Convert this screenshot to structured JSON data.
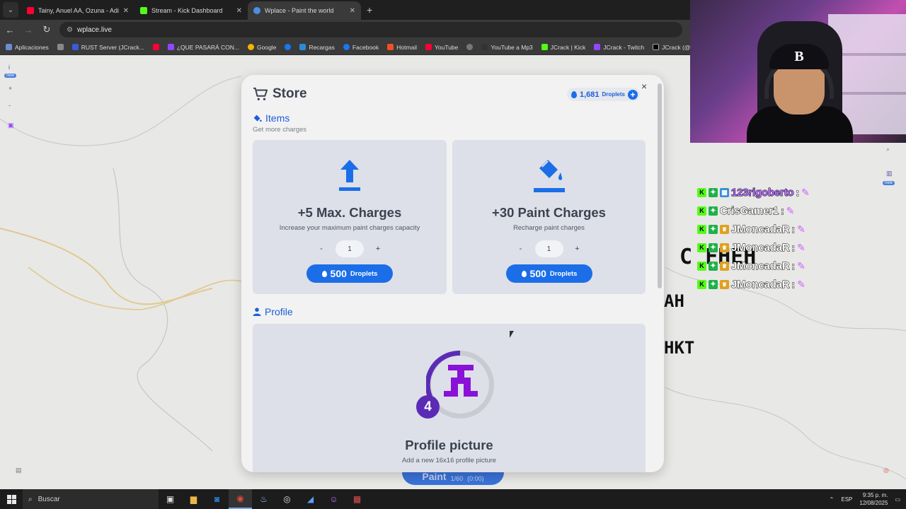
{
  "browser": {
    "tabs": [
      {
        "title": "Tainy, Anuel AA, Ozuna - Adicto",
        "color": "#ff0033",
        "active": false
      },
      {
        "title": "Stream - Kick Dashboard",
        "color": "#53fc18",
        "active": false
      },
      {
        "title": "Wplace - Paint the world",
        "color": "#4a90e2",
        "active": true
      }
    ],
    "new_tab_label": "+",
    "url": "wplace.live",
    "bookmarks": [
      {
        "label": "Aplicaciones",
        "color": "#6d8cd0"
      },
      {
        "label": "",
        "color": "#888888"
      },
      {
        "label": "RUST Server (JCrack...",
        "color": "#3c5bd6"
      },
      {
        "label": "",
        "color": "#ff0033"
      },
      {
        "label": "¿QUE PASARÁ CON...",
        "color": "#9146ff"
      },
      {
        "label": "Google",
        "color": "#f4b400"
      },
      {
        "label": "",
        "color": "#1877f2"
      },
      {
        "label": "Recargas",
        "color": "#2a8cd8"
      },
      {
        "label": "Facebook",
        "color": "#1877f2"
      },
      {
        "label": "Hotmail",
        "color": "#f25022"
      },
      {
        "label": "YouTube",
        "color": "#ff0033"
      },
      {
        "label": "",
        "color": "#777777"
      },
      {
        "label": "YouTube a Mp3",
        "color": "#333333"
      },
      {
        "label": "JCrack | Kick",
        "color": "#53fc18"
      },
      {
        "label": "JCrack - Twitch",
        "color": "#9146ff"
      },
      {
        "label": "JCrack (@JCrac...",
        "color": "#000000"
      }
    ]
  },
  "map": {
    "new_badge": "new",
    "paint_button": {
      "label": "Paint",
      "sub": "1/60",
      "extra": "(0:00)"
    },
    "pixel_text": [
      "C FHEH",
      "AH",
      "HKT"
    ]
  },
  "store": {
    "title": "Store",
    "droplets_value": "1,681",
    "droplets_unit": "Droplets",
    "close_label": "×",
    "items_section": {
      "title": "Items",
      "subtitle": "Get more charges"
    },
    "items": [
      {
        "title": "+5 Max. Charges",
        "description": "Increase your maximum paint charges capacity",
        "quantity": "1",
        "price": "500",
        "unit": "Droplets",
        "minus": "-",
        "plus": "+"
      },
      {
        "title": "+30 Paint Charges",
        "description": "Recharge paint charges",
        "quantity": "1",
        "price": "500",
        "unit": "Droplets",
        "minus": "-",
        "plus": "+"
      }
    ],
    "profile_section": {
      "title": "Profile"
    },
    "profile_item": {
      "title": "Profile picture",
      "description": "Add a new 16x16 profile picture",
      "level": "4"
    }
  },
  "chat": [
    {
      "name": "123rigoberto",
      "color": "#b46bff"
    },
    {
      "name": "CrisGamer1",
      "color": "#ffffff"
    },
    {
      "name": "JMoncadaR",
      "color": "#ffffff"
    },
    {
      "name": "JMoncadaR",
      "color": "#ffffff"
    },
    {
      "name": "JMoncadaR",
      "color": "#ffffff"
    },
    {
      "name": "JMoncadaR",
      "color": "#ffffff"
    }
  ],
  "chat_separator": ":",
  "webcam_cap_letter": "B",
  "taskbar": {
    "search_placeholder": "Buscar",
    "language": "ESP",
    "time": "9:35 p. m.",
    "date": "12/08/2025"
  },
  "colors": {
    "accent": "#1b6ee8",
    "modal_bg": "#f2f2f3",
    "card_bg": "#dde0e8",
    "level_badge": "#5b2bb6",
    "avatar_purple": "#8a12d8"
  }
}
